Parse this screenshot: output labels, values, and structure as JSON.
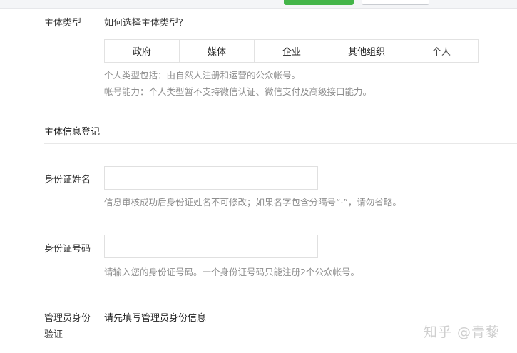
{
  "subject_type": {
    "label": "主体类型",
    "help_link": "如何选择主体类型？",
    "options": [
      "政府",
      "媒体",
      "企业",
      "其他组织",
      "个人"
    ],
    "selected": "个人",
    "notes": [
      "个人类型包括：由自然人注册和运营的公众帐号。",
      "帐号能力：个人类型暂不支持微信认证、微信支付及高级接口能力。"
    ]
  },
  "registration": {
    "section_title": "主体信息登记",
    "id_name": {
      "label": "身份证姓名",
      "value": "",
      "hint": "信息审核成功后身份证姓名不可修改；如果名字包含分隔号“·”，请勿省略。"
    },
    "id_number": {
      "label": "身份证号码",
      "value": "",
      "hint": "请输入您的身份证号码。一个身份证号码只能注册2个公众帐号。"
    },
    "admin_verify": {
      "label_line1": "管理员身份",
      "label_line2": "验证",
      "text": "请先填写管理员身份信息"
    }
  },
  "watermark": "知乎 @青藜"
}
